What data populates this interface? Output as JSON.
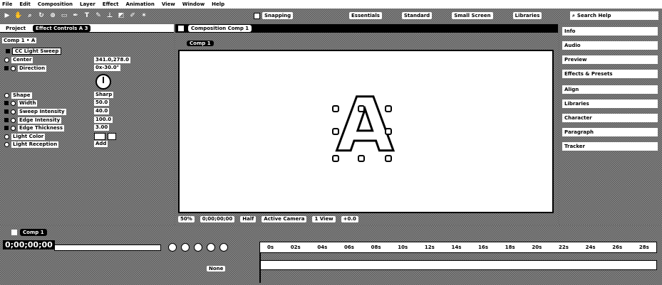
{
  "menu": [
    "File",
    "Edit",
    "Composition",
    "Layer",
    "Effect",
    "Animation",
    "View",
    "Window",
    "Help"
  ],
  "toolbar": {
    "snapping_label": "Snapping",
    "workspaces": [
      "Essentials",
      "Standard",
      "Small Screen",
      "Libraries"
    ],
    "search_placeholder": "Search Help"
  },
  "left_panel": {
    "tabs": [
      "Project",
      "Effect Controls A 3"
    ],
    "layer_path": "Comp 1 • A",
    "effect_name": "CC Light Sweep",
    "properties": [
      {
        "name": "Center",
        "value": "341.0,278.0"
      },
      {
        "name": "Direction",
        "value": "0x-30.0°"
      },
      {
        "name": "Shape",
        "value": "Sharp"
      },
      {
        "name": "Width",
        "value": "50.0"
      },
      {
        "name": "Sweep Intensity",
        "value": "40.0"
      },
      {
        "name": "Edge Intensity",
        "value": "100.0"
      },
      {
        "name": "Edge Thickness",
        "value": "3.00"
      },
      {
        "name": "Light Color",
        "value": ""
      },
      {
        "name": "Light Reception",
        "value": "Add"
      }
    ]
  },
  "comp_panel": {
    "tab_label": "Composition Comp 1",
    "breadcrumb": "Comp 1",
    "canvas_letter": "A",
    "footer": {
      "zoom": "50%",
      "time": "0;00;00;00",
      "resolution": "Half",
      "camera": "Active Camera",
      "views": "1 View",
      "exposure": "+0.0"
    }
  },
  "right_panel": {
    "items": [
      "Info",
      "Audio",
      "Preview",
      "Effects & Presets",
      "Align",
      "Libraries",
      "Character",
      "Paragraph",
      "Tracker"
    ]
  },
  "timeline": {
    "tab_label": "Comp 1",
    "timecode": "0;00;00;00",
    "column_label": "None",
    "ruler_ticks": [
      "0s",
      "02s",
      "04s",
      "06s",
      "08s",
      "10s",
      "12s",
      "14s",
      "16s",
      "18s",
      "20s",
      "22s",
      "24s",
      "26s",
      "28s"
    ]
  }
}
